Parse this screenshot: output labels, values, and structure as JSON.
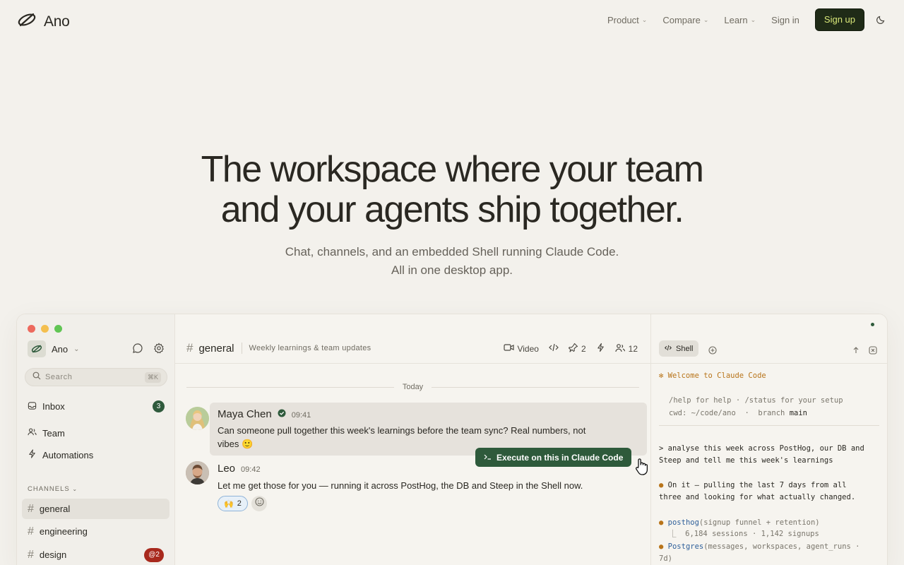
{
  "brand": {
    "name": "Ano"
  },
  "nav": {
    "links": [
      {
        "label": "Product"
      },
      {
        "label": "Compare"
      },
      {
        "label": "Learn"
      }
    ],
    "signin": "Sign in",
    "signup": "Sign up"
  },
  "hero": {
    "title_line1": "The workspace where your team",
    "title_line2": "and your agents ship together.",
    "sub_line1": "Chat, channels, and an embedded Shell running Claude Code.",
    "sub_line2": "All in one desktop app."
  },
  "app": {
    "workspace": "Ano",
    "search": {
      "placeholder": "Search",
      "shortcut": "⌘K"
    },
    "nav_items": [
      {
        "label": "Inbox",
        "badge": "3"
      },
      {
        "label": "Team"
      },
      {
        "label": "Automations"
      }
    ],
    "channels_label": "CHANNELS",
    "channels": [
      {
        "name": "general",
        "active": true
      },
      {
        "name": "engineering"
      },
      {
        "name": "design",
        "badge": "@2"
      }
    ],
    "channel": {
      "name": "general",
      "description": "Weekly learnings & team updates",
      "video_label": "Video",
      "pins": "2",
      "members": "12"
    },
    "day_divider": "Today",
    "messages": [
      {
        "author": "Maya Chen",
        "time": "09:41",
        "text_line1": "Can someone pull together this week's learnings before the team sync? Real numbers, not",
        "text_line2": "vibes 🙂"
      },
      {
        "author": "Leo",
        "time": "09:42",
        "text": "Let me get those for you — running it across PostHog, the DB and Steep in the Shell now.",
        "reaction": {
          "emoji": "🙌",
          "count": "2"
        }
      }
    ],
    "execute_button": "Execute on this in Claude Code",
    "shell": {
      "tab_label": "Shell",
      "welcome": "✻ Welcome to Claude Code",
      "help": "/help for help · /status for your setup",
      "cwd_label": "cwd: ~/code/ano  ·  branch",
      "branch": "main",
      "prompt_line1": "> analyse this week across PostHog, our DB and",
      "prompt_line2": "Steep and tell me this week's learnings",
      "reply_line1": "On it — pulling the last 7 days from all",
      "reply_line2": "three and looking for what actually changed.",
      "tool1_name": "posthog",
      "tool1_args": "(signup funnel + retention)",
      "tool1_result": "⎿  6,184 sessions · 1,142 signups",
      "tool2_name": "Postgres",
      "tool2_args": "(messages, workspaces, agent_runs ·",
      "tool2_args_cont": "7d)"
    }
  },
  "colors": {
    "background": "#f3f1ec",
    "accent_green": "#2e5a3b",
    "signup_bg": "#1f2b17",
    "signup_text": "#d9e879",
    "badge_red": "#a8291d"
  },
  "icons": [
    "ano-logo-icon",
    "chevron-down-icon",
    "moon-icon",
    "chat-bubble-icon",
    "gear-icon",
    "search-icon",
    "inbox-icon",
    "team-icon",
    "bolt-icon",
    "hash-icon",
    "video-icon",
    "code-icon",
    "pin-icon",
    "members-icon",
    "terminal-icon",
    "plus-circle-icon",
    "share-icon",
    "close-square-icon",
    "verified-icon",
    "smiley-add-icon",
    "cursor-hand-icon"
  ]
}
